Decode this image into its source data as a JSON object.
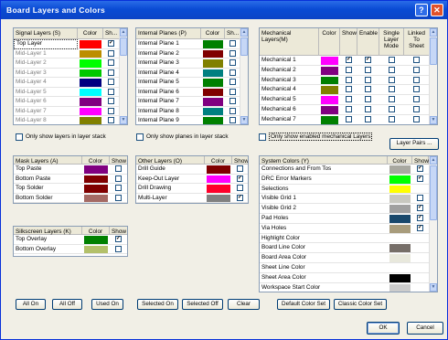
{
  "title": "Board Layers and Colors",
  "title_buttons": {
    "help": "?",
    "close": "✕"
  },
  "signal": {
    "headers": [
      "Signal Layers (S)",
      "Color",
      "Sh..."
    ],
    "rows": [
      {
        "name": "Top Layer",
        "color": "#ff0000",
        "show": true,
        "active": true
      },
      {
        "name": "Mid-Layer 1",
        "color": "#bc8e00",
        "show": false
      },
      {
        "name": "Mid-Layer 2",
        "color": "#00ff00",
        "show": false
      },
      {
        "name": "Mid-Layer 3",
        "color": "#00c800",
        "show": false
      },
      {
        "name": "Mid-Layer 4",
        "color": "#000080",
        "show": false
      },
      {
        "name": "Mid-Layer 5",
        "color": "#00ffff",
        "show": false
      },
      {
        "name": "Mid-Layer 6",
        "color": "#800080",
        "show": false
      },
      {
        "name": "Mid-Layer 7",
        "color": "#ff00ff",
        "show": false
      },
      {
        "name": "Mid-Layer 8",
        "color": "#808000",
        "show": false
      }
    ]
  },
  "internal": {
    "headers": [
      "Internal Planes (P)",
      "Color",
      "Sh..."
    ],
    "rows": [
      {
        "name": "Internal Plane 1",
        "color": "#008000",
        "show": false
      },
      {
        "name": "Internal Plane 2",
        "color": "#800000",
        "show": false
      },
      {
        "name": "Internal Plane 3",
        "color": "#808000",
        "show": false
      },
      {
        "name": "Internal Plane 4",
        "color": "#008080",
        "show": false
      },
      {
        "name": "Internal Plane 5",
        "color": "#008000",
        "show": false
      },
      {
        "name": "Internal Plane 6",
        "color": "#800000",
        "show": false
      },
      {
        "name": "Internal Plane 7",
        "color": "#800080",
        "show": false
      },
      {
        "name": "Internal Plane 8",
        "color": "#008080",
        "show": false
      },
      {
        "name": "Internal Plane 9",
        "color": "#008000",
        "show": false
      }
    ]
  },
  "mechanical": {
    "headers": [
      "Mechanical Layers(M)",
      "Color",
      "Show",
      "Enable",
      "Single Layer Mode",
      "Linked To Sheet"
    ],
    "rows": [
      {
        "name": "Mechanical 1",
        "color": "#ff00ff",
        "show": true,
        "enable": true,
        "single": false,
        "linked": false
      },
      {
        "name": "Mechanical 2",
        "color": "#800080",
        "show": false,
        "enable": false,
        "single": false,
        "linked": false
      },
      {
        "name": "Mechanical 3",
        "color": "#008000",
        "show": false,
        "enable": false,
        "single": false,
        "linked": false
      },
      {
        "name": "Mechanical 4",
        "color": "#808000",
        "show": false,
        "enable": false,
        "single": false,
        "linked": false
      },
      {
        "name": "Mechanical 5",
        "color": "#ff00ff",
        "show": false,
        "enable": false,
        "single": false,
        "linked": false
      },
      {
        "name": "Mechanical 6",
        "color": "#800080",
        "show": false,
        "enable": false,
        "single": false,
        "linked": false
      },
      {
        "name": "Mechanical 7",
        "color": "#008000",
        "show": false,
        "enable": false,
        "single": false,
        "linked": false
      }
    ]
  },
  "options": {
    "only_layers": "Only show layers in layer stack",
    "only_planes": "Only show planes in layer stack",
    "only_mech": "Only show enabled mechanical Layers",
    "layer_pairs": "Layer Pairs ..."
  },
  "mask": {
    "headers": [
      "Mask Layers (A)",
      "Color",
      "Show"
    ],
    "rows": [
      {
        "name": "Top Paste",
        "color": "#800080",
        "show": false
      },
      {
        "name": "Bottom Paste",
        "color": "#800000",
        "show": false
      },
      {
        "name": "Top Solder",
        "color": "#800000",
        "show": false
      },
      {
        "name": "Bottom Solder",
        "color": "#a56a64",
        "show": false
      }
    ]
  },
  "other": {
    "headers": [
      "Other Layers (O)",
      "Color",
      "Show"
    ],
    "rows": [
      {
        "name": "Drill Guide",
        "color": "#800000",
        "show": false
      },
      {
        "name": "Keep-Out Layer",
        "color": "#ff00ff",
        "show": true
      },
      {
        "name": "Drill Drawing",
        "color": "#ff002a",
        "show": false
      },
      {
        "name": "Multi-Layer",
        "color": "#808080",
        "show": true
      }
    ]
  },
  "silkscreen": {
    "headers": [
      "Silkscreen Layers (K)",
      "Color",
      "Show"
    ],
    "rows": [
      {
        "name": "Top Overlay",
        "color": "#008000",
        "show": true
      },
      {
        "name": "Bottom Overlay",
        "color": "#b3c06a",
        "show": false
      }
    ]
  },
  "system": {
    "headers": [
      "System Colors (Y)",
      "Color",
      "Show"
    ],
    "rows": [
      {
        "name": "Connections and From Tos",
        "color": "#a8a8a0",
        "show": true
      },
      {
        "name": "DRC Error Markers",
        "color": "#00ff00",
        "show": true
      },
      {
        "name": "Selections",
        "color": "#ffff00",
        "show": null
      },
      {
        "name": "Visible Grid 1",
        "color": "#c8c8c0",
        "show": false
      },
      {
        "name": "Visible Grid 2",
        "color": "#a0a0a0",
        "show": true
      },
      {
        "name": "Pad Holes",
        "color": "#18486c",
        "show": true
      },
      {
        "name": "Via Holes",
        "color": "#a89c7c",
        "show": true
      },
      {
        "name": "Highlight Color",
        "color": "#ffffff",
        "show": null
      },
      {
        "name": "Board Line Color",
        "color": "#766e68",
        "show": null
      },
      {
        "name": "Board Area Color",
        "color": "#e8e8dc",
        "show": null
      },
      {
        "name": "Sheet Line Color",
        "color": "#ffffff",
        "show": null
      },
      {
        "name": "Sheet Area Color",
        "color": "#000000",
        "show": null
      },
      {
        "name": "Workspace Start Color",
        "color": "#cccccc",
        "show": null
      }
    ]
  },
  "buttons": {
    "all_on": "All On",
    "all_off": "All Off",
    "used_on": "Used On",
    "selected_on": "Selected On",
    "selected_off": "Selected Off",
    "clear": "Clear",
    "default_set": "Default Color Set",
    "classic_set": "Classic Color Set",
    "ok": "OK",
    "cancel": "Cancel"
  }
}
